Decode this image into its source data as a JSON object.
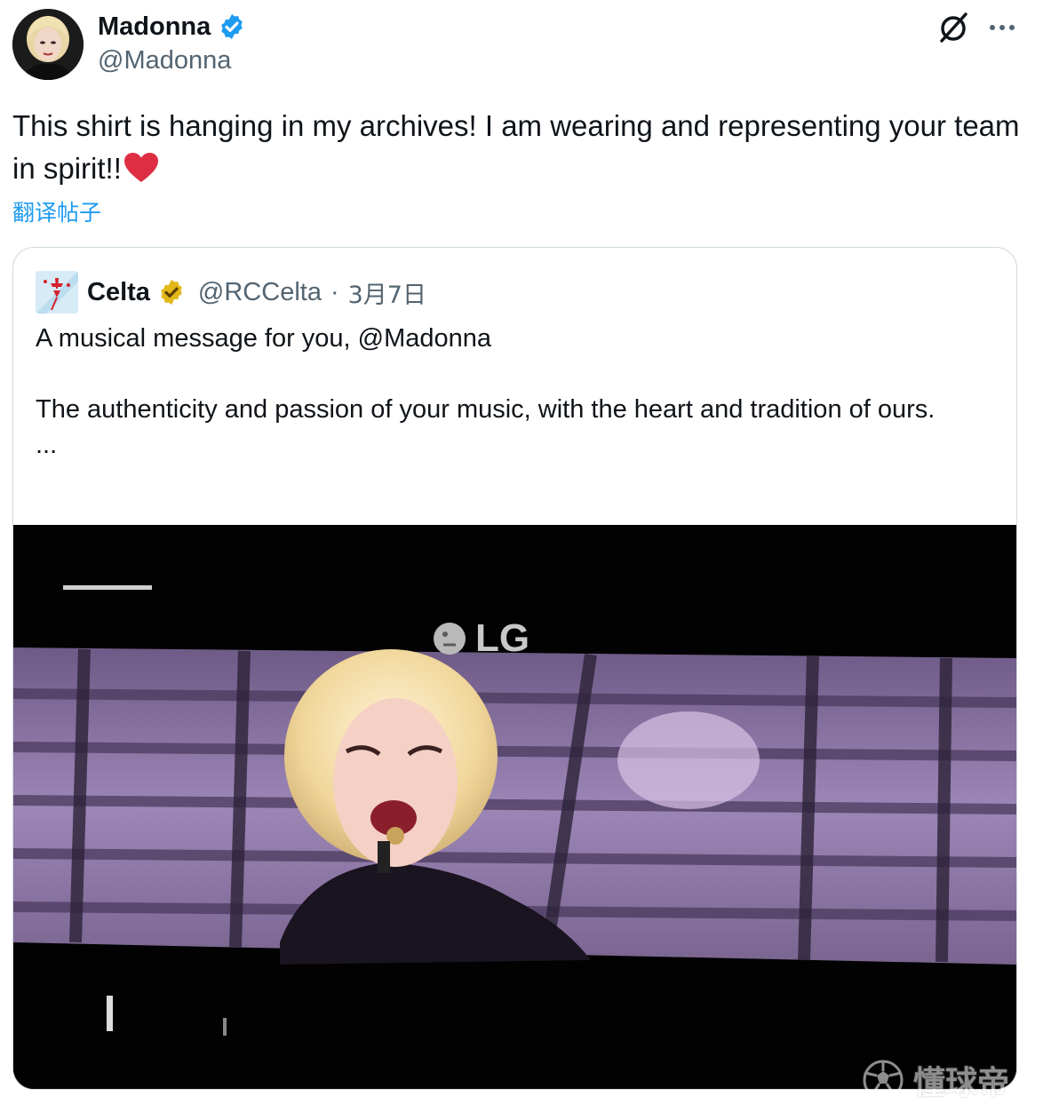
{
  "author": {
    "name": "Madonna",
    "handle": "@Madonna",
    "verified_color": "#1d9bf0"
  },
  "actions": {
    "grok_icon": "grok-icon",
    "more_icon": "more-icon"
  },
  "tweet": {
    "text": "This shirt is hanging in my archives! I am wearing and representing your team in spirit!!",
    "emoji": "❤️",
    "translate_label": "翻译帖子"
  },
  "quote": {
    "name": "Celta",
    "handle": "@RCCelta",
    "separator": "·",
    "date": "3月7日",
    "verified_color": "#e2b719",
    "line1": "A musical message for you, @Madonna",
    "line2": "The authenticity and passion of your music, with the heart and tradition of ours.",
    "line3": "...",
    "media": {
      "screen_logo": "LG"
    }
  },
  "watermark": {
    "text": "懂球帝"
  }
}
